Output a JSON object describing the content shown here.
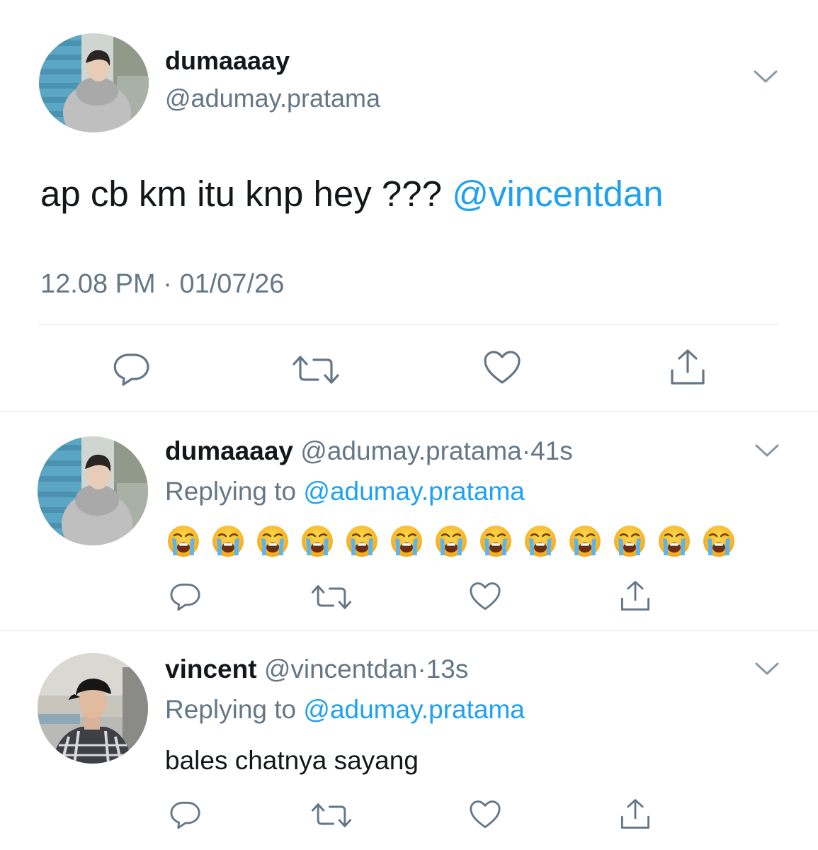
{
  "main_tweet": {
    "display_name": "dumaaaay",
    "handle": "@adumay.pratama",
    "text": "ap cb km itu knp hey ???",
    "mention": "@vincentdan",
    "time": "12.08 PM",
    "separator": "·",
    "date": "01/07/26",
    "avatar_icon": "profile-photo-grey-hoodie"
  },
  "replies": [
    {
      "display_name": "dumaaaay",
      "handle": "@adumay.pratama",
      "separator": "·",
      "age": "41s",
      "replying_label": "Replying to",
      "replying_handle": "@adumay.pratama",
      "emoji_name": "loudly-crying-face-emoji",
      "emoji_count": 13,
      "avatar_icon": "profile-photo-grey-hoodie"
    },
    {
      "display_name": "vincent",
      "handle": "@vincentdan",
      "separator": "·",
      "age": "13s",
      "replying_label": "Replying to",
      "replying_handle": "@adumay.pratama",
      "text": "bales chatnya sayang",
      "avatar_icon": "profile-photo-cap-plaid-shirt"
    }
  ],
  "actions": [
    "reply-icon",
    "retweet-icon",
    "like-icon",
    "share-icon"
  ],
  "colors": {
    "link": "#1da1f2",
    "secondary_text": "#657786",
    "icon": "#657786",
    "divider": "#e1e8ed",
    "text": "#14171a"
  }
}
